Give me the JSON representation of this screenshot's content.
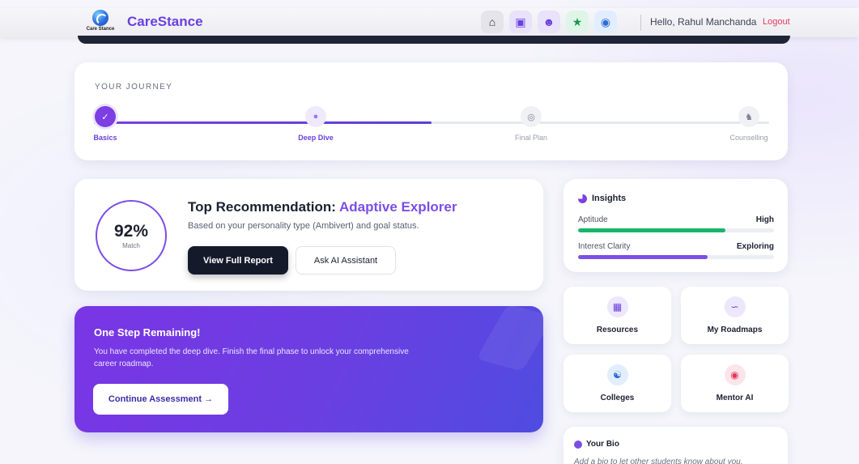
{
  "header": {
    "brand": "CareStance",
    "logo_text": "Care Stance",
    "greeting": "Hello, Rahul Manchanda",
    "logout_label": "Logout",
    "nav_icons": [
      "home-icon",
      "bot-icon",
      "users-icon",
      "star-icon",
      "help-icon"
    ]
  },
  "journey": {
    "title": "YOUR JOURNEY",
    "progress": 0.5,
    "steps": [
      {
        "label": "Basics",
        "status": "done"
      },
      {
        "label": "Deep Dive",
        "status": "active"
      },
      {
        "label": "Final Plan",
        "status": "pending"
      },
      {
        "label": "Counselling",
        "status": "pending"
      }
    ]
  },
  "recommendation": {
    "match_value": "92%",
    "match_label": "Match",
    "title_prefix": "Top Recommendation: ",
    "title_accent": "Adaptive Explorer",
    "subtitle": "Based on your personality type (Ambivert) and goal status.",
    "primary_button": "View Full Report",
    "secondary_button": "Ask AI Assistant"
  },
  "promo": {
    "title": "One Step Remaining!",
    "text": "You have completed the deep dive. Finish the final phase to unlock your comprehensive career roadmap.",
    "button": "Continue Assessment →"
  },
  "insights": {
    "title": "Insights",
    "rows": [
      {
        "label": "Aptitude",
        "value": "High",
        "level": 0.75,
        "color": "#18b56a"
      },
      {
        "label": "Interest Clarity",
        "value": "Exploring",
        "level": 0.66,
        "color": "#7b50e6"
      }
    ]
  },
  "tiles": [
    {
      "label": "Resources",
      "icon": "book-icon"
    },
    {
      "label": "My Roadmaps",
      "icon": "route-icon"
    },
    {
      "label": "Colleges",
      "icon": "building-icon"
    },
    {
      "label": "Mentor AI",
      "icon": "chat-icon"
    }
  ],
  "bio": {
    "title": "Your Bio",
    "placeholder": "Add a bio to let other students know about you."
  },
  "colors": {
    "brand": "#6a3fe0",
    "accent_green": "#18b56a",
    "dark_button": "#151a2b",
    "logout": "#e23a5a"
  }
}
